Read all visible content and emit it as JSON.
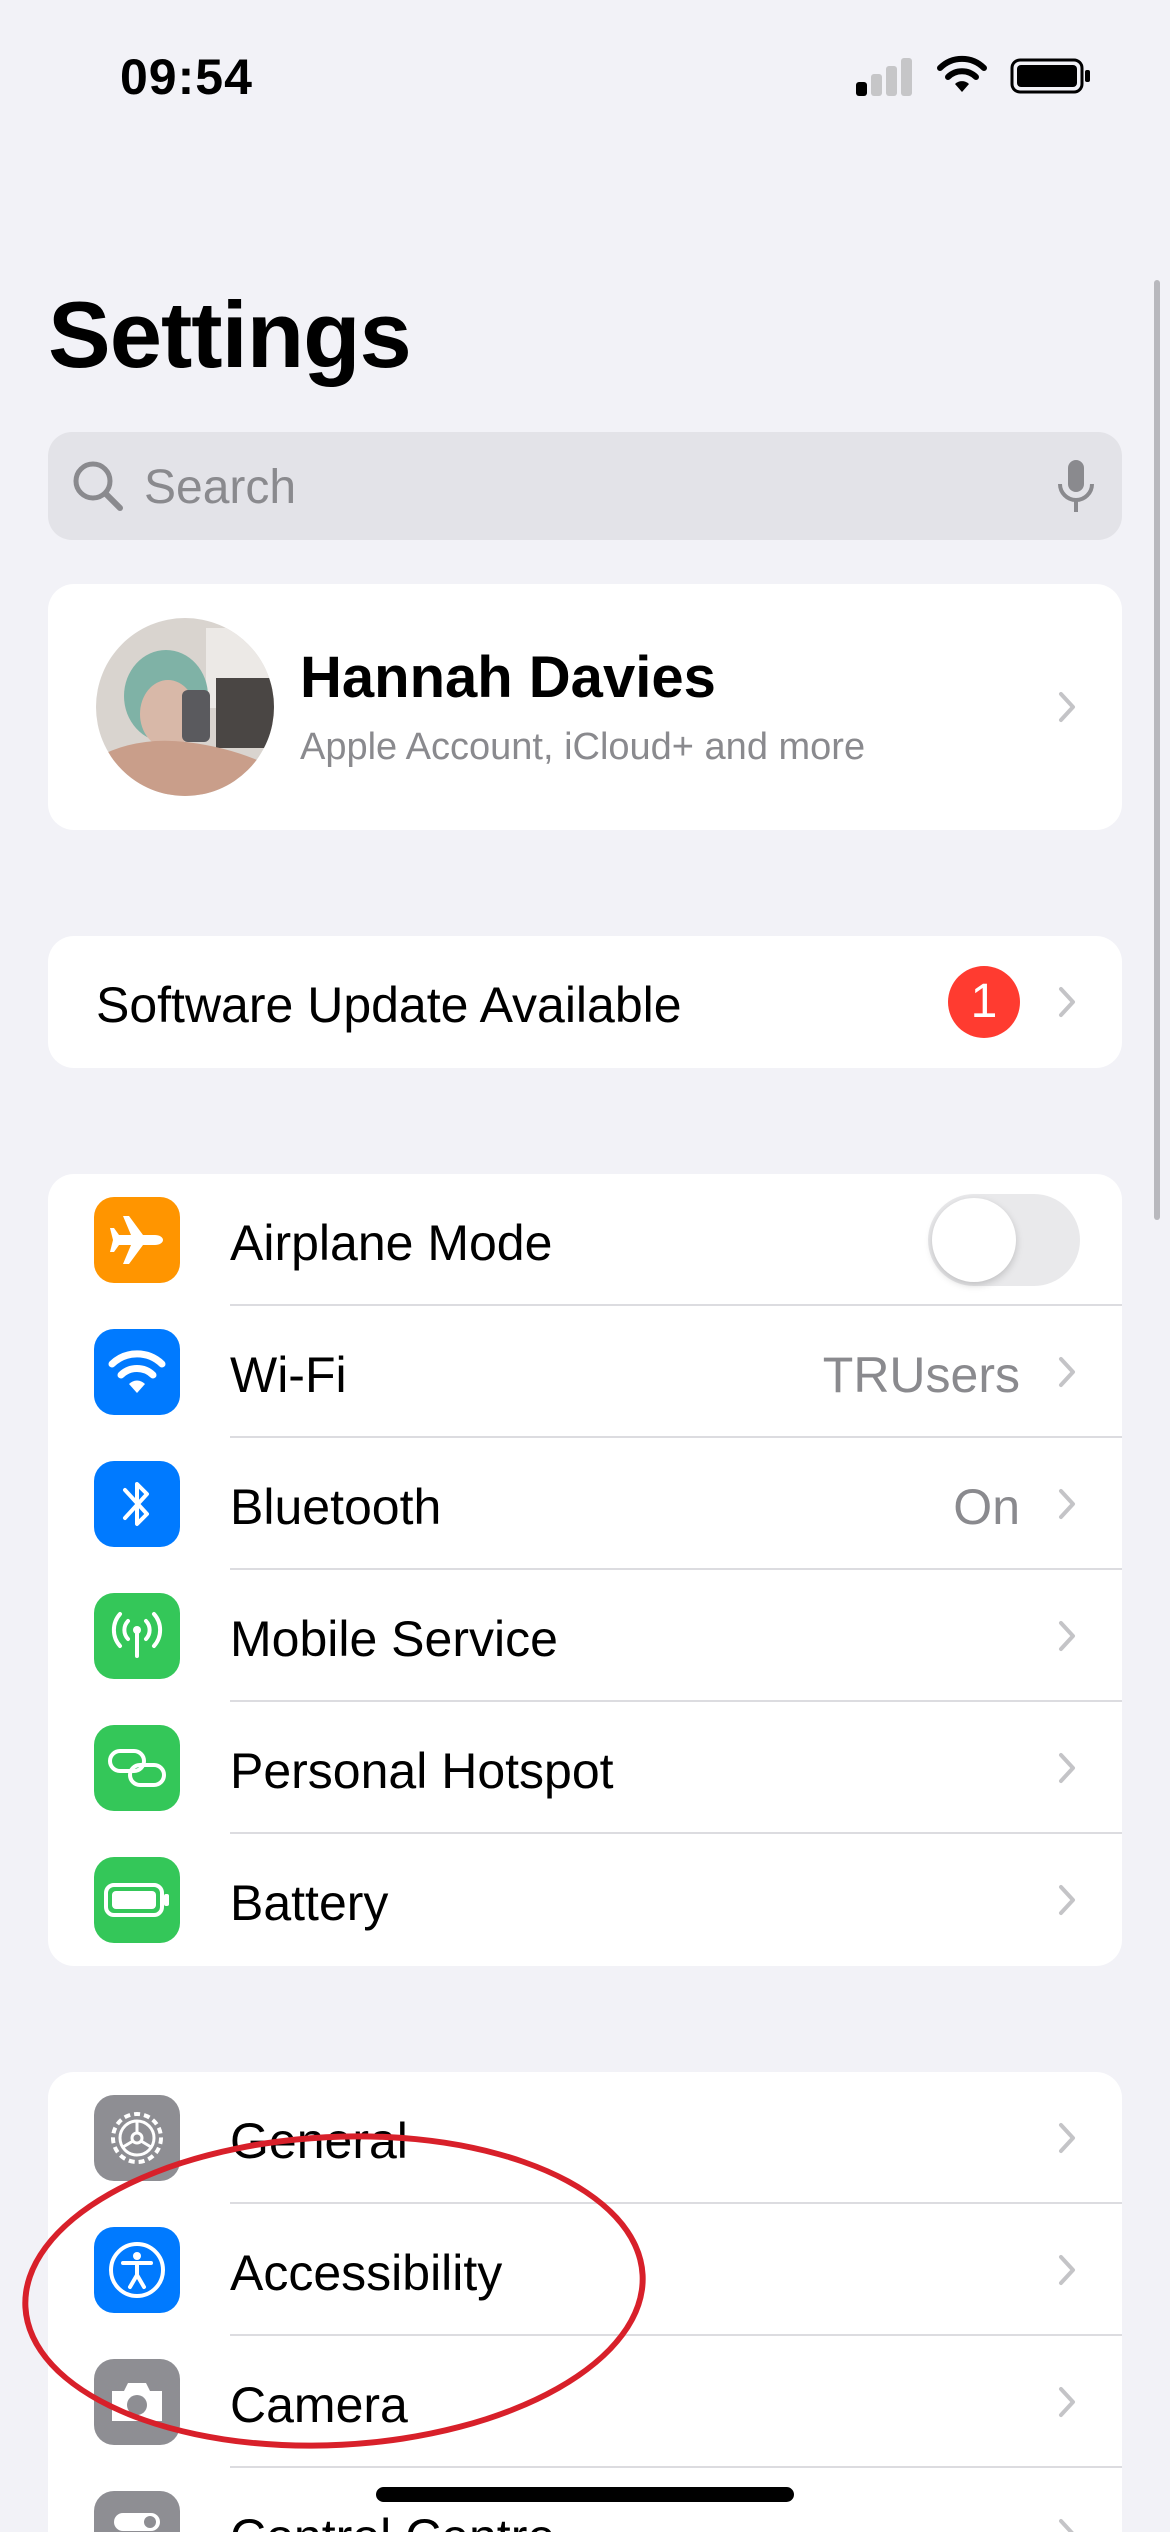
{
  "status_bar": {
    "time": "09:54",
    "signal_icon": "cellular-signal-icon",
    "wifi_icon": "wifi-icon",
    "battery_icon": "battery-icon"
  },
  "header": {
    "title": "Settings"
  },
  "search": {
    "placeholder": "Search",
    "search_icon": "magnifying-glass-icon",
    "mic_icon": "microphone-icon"
  },
  "profile": {
    "name": "Hannah Davies",
    "subtitle": "Apple Account, iCloud+ and more"
  },
  "software_update": {
    "label": "Software Update Available",
    "badge": "1",
    "badge_color": "#ff3b30"
  },
  "connectivity": {
    "items": [
      {
        "label": "Airplane Mode",
        "icon": "airplane-icon",
        "color": "#ff9500",
        "toggle": false
      },
      {
        "label": "Wi-Fi",
        "icon": "wifi-icon",
        "color": "#007aff",
        "value": "TRUsers"
      },
      {
        "label": "Bluetooth",
        "icon": "bluetooth-icon",
        "color": "#007aff",
        "value": "On"
      },
      {
        "label": "Mobile Service",
        "icon": "antenna-icon",
        "color": "#34c759"
      },
      {
        "label": "Personal Hotspot",
        "icon": "link-icon",
        "color": "#34c759"
      },
      {
        "label": "Battery",
        "icon": "battery-icon",
        "color": "#34c759"
      }
    ]
  },
  "general_group": {
    "items": [
      {
        "label": "General",
        "icon": "gear-icon",
        "color": "#8e8e93"
      },
      {
        "label": "Accessibility",
        "icon": "accessibility-icon",
        "color": "#007aff"
      },
      {
        "label": "Camera",
        "icon": "camera-icon",
        "color": "#8e8e93"
      },
      {
        "label": "Control Centre",
        "icon": "switches-icon",
        "color": "#8e8e93"
      }
    ]
  },
  "annotation": {
    "color": "#d8202a",
    "target": "Accessibility"
  }
}
